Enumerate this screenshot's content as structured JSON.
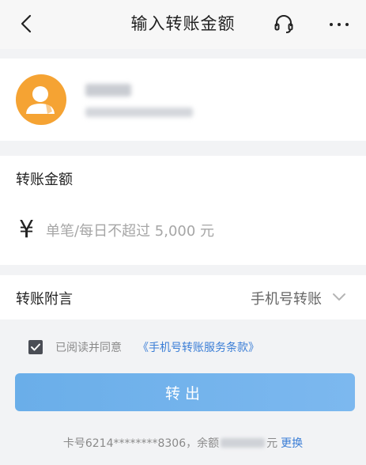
{
  "header": {
    "title": "输入转账金额",
    "icons": {
      "back": "chevron-left-icon",
      "service": "headset-icon",
      "more": "more-dots-icon"
    }
  },
  "payee": {
    "avatar_icon": "person-avatar-icon",
    "avatar_color": "#f5a333"
  },
  "amount": {
    "label": "转账金额",
    "currency_symbol": "¥",
    "value": "",
    "placeholder": "单笔/每日不超过 5,000 元"
  },
  "remark": {
    "label": "转账附言",
    "value": "手机号转账"
  },
  "agreement": {
    "checked": true,
    "text": "已阅读并同意",
    "link": "《手机号转账服务条款》"
  },
  "submit": {
    "label": "转出",
    "color": "#6aaee9"
  },
  "card_info": {
    "card_prefix": "卡号6214********8306，",
    "balance_label": "余额",
    "balance_unit": "元",
    "change_link": "更换"
  },
  "colors": {
    "accent": "#3b7ed6",
    "background": "#f2f3f5"
  }
}
